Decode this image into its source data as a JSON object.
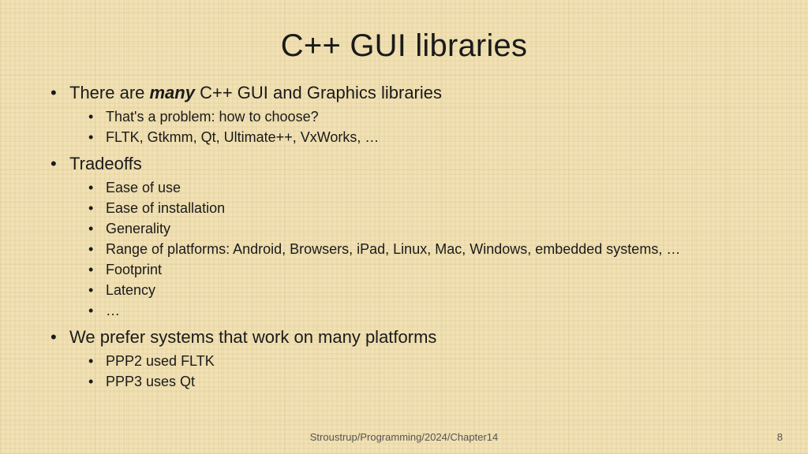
{
  "title": "C++ GUI libraries",
  "bullets": [
    {
      "pre": "There are ",
      "em": "many",
      "post": " C++ GUI and Graphics libraries",
      "sub": [
        "That's a problem: how to choose?",
        "FLTK, Gtkmm, Qt, Ultimate++, VxWorks, …"
      ]
    },
    {
      "text": "Tradeoffs",
      "sub": [
        "Ease of use",
        "Ease of installation",
        "Generality",
        "Range of platforms: Android, Browsers, iPad, Linux, Mac, Windows, embedded systems, …",
        "Footprint",
        "Latency",
        "…"
      ]
    },
    {
      "text": "We prefer systems that work on many platforms",
      "sub": [
        "PPP2 used FLTK",
        "PPP3 uses Qt"
      ]
    }
  ],
  "footer": {
    "center": "Stroustrup/Programming/2024/Chapter14",
    "page": "8"
  }
}
